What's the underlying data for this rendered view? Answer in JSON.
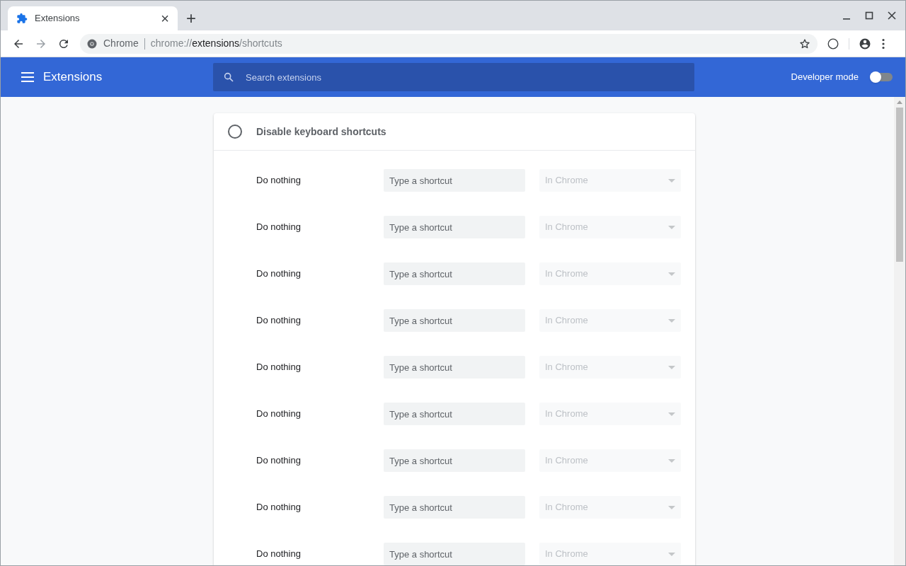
{
  "tab": {
    "title": "Extensions",
    "close": "×",
    "selected": true
  },
  "new_tab": "+",
  "address_bar": {
    "site": "Chrome",
    "url_scheme": "chrome://",
    "url_host": "extensions",
    "url_path": "/shortcuts"
  },
  "header": {
    "title": "Extensions",
    "search": {
      "placeholder": "Search extensions"
    },
    "developer_mode": {
      "label": "Developer mode",
      "on": false
    }
  },
  "disable_shortcuts": {
    "label": "Disable keyboard shortcuts",
    "checked": false
  },
  "commands": [
    {
      "label": "Do nothing",
      "shortcut": {
        "placeholder": "Type a shortcut"
      },
      "scope": {
        "value": "In Chrome",
        "disabled": true
      }
    },
    {
      "label": "Do nothing",
      "shortcut": {
        "placeholder": "Type a shortcut"
      },
      "scope": {
        "value": "In Chrome",
        "disabled": true
      }
    },
    {
      "label": "Do nothing",
      "shortcut": {
        "placeholder": "Type a shortcut"
      },
      "scope": {
        "value": "In Chrome",
        "disabled": true
      }
    },
    {
      "label": "Do nothing",
      "shortcut": {
        "placeholder": "Type a shortcut"
      },
      "scope": {
        "value": "In Chrome",
        "disabled": true
      }
    },
    {
      "label": "Do nothing",
      "shortcut": {
        "placeholder": "Type a shortcut"
      },
      "scope": {
        "value": "In Chrome",
        "disabled": true
      }
    },
    {
      "label": "Do nothing",
      "shortcut": {
        "placeholder": "Type a shortcut"
      },
      "scope": {
        "value": "In Chrome",
        "disabled": true
      }
    },
    {
      "label": "Do nothing",
      "shortcut": {
        "placeholder": "Type a shortcut"
      },
      "scope": {
        "value": "In Chrome",
        "disabled": true
      }
    },
    {
      "label": "Do nothing",
      "shortcut": {
        "placeholder": "Type a shortcut"
      },
      "scope": {
        "value": "In Chrome",
        "disabled": true
      }
    },
    {
      "label": "Do nothing",
      "shortcut": {
        "placeholder": "Type a shortcut"
      },
      "scope": {
        "value": "In Chrome",
        "disabled": true
      }
    }
  ]
}
